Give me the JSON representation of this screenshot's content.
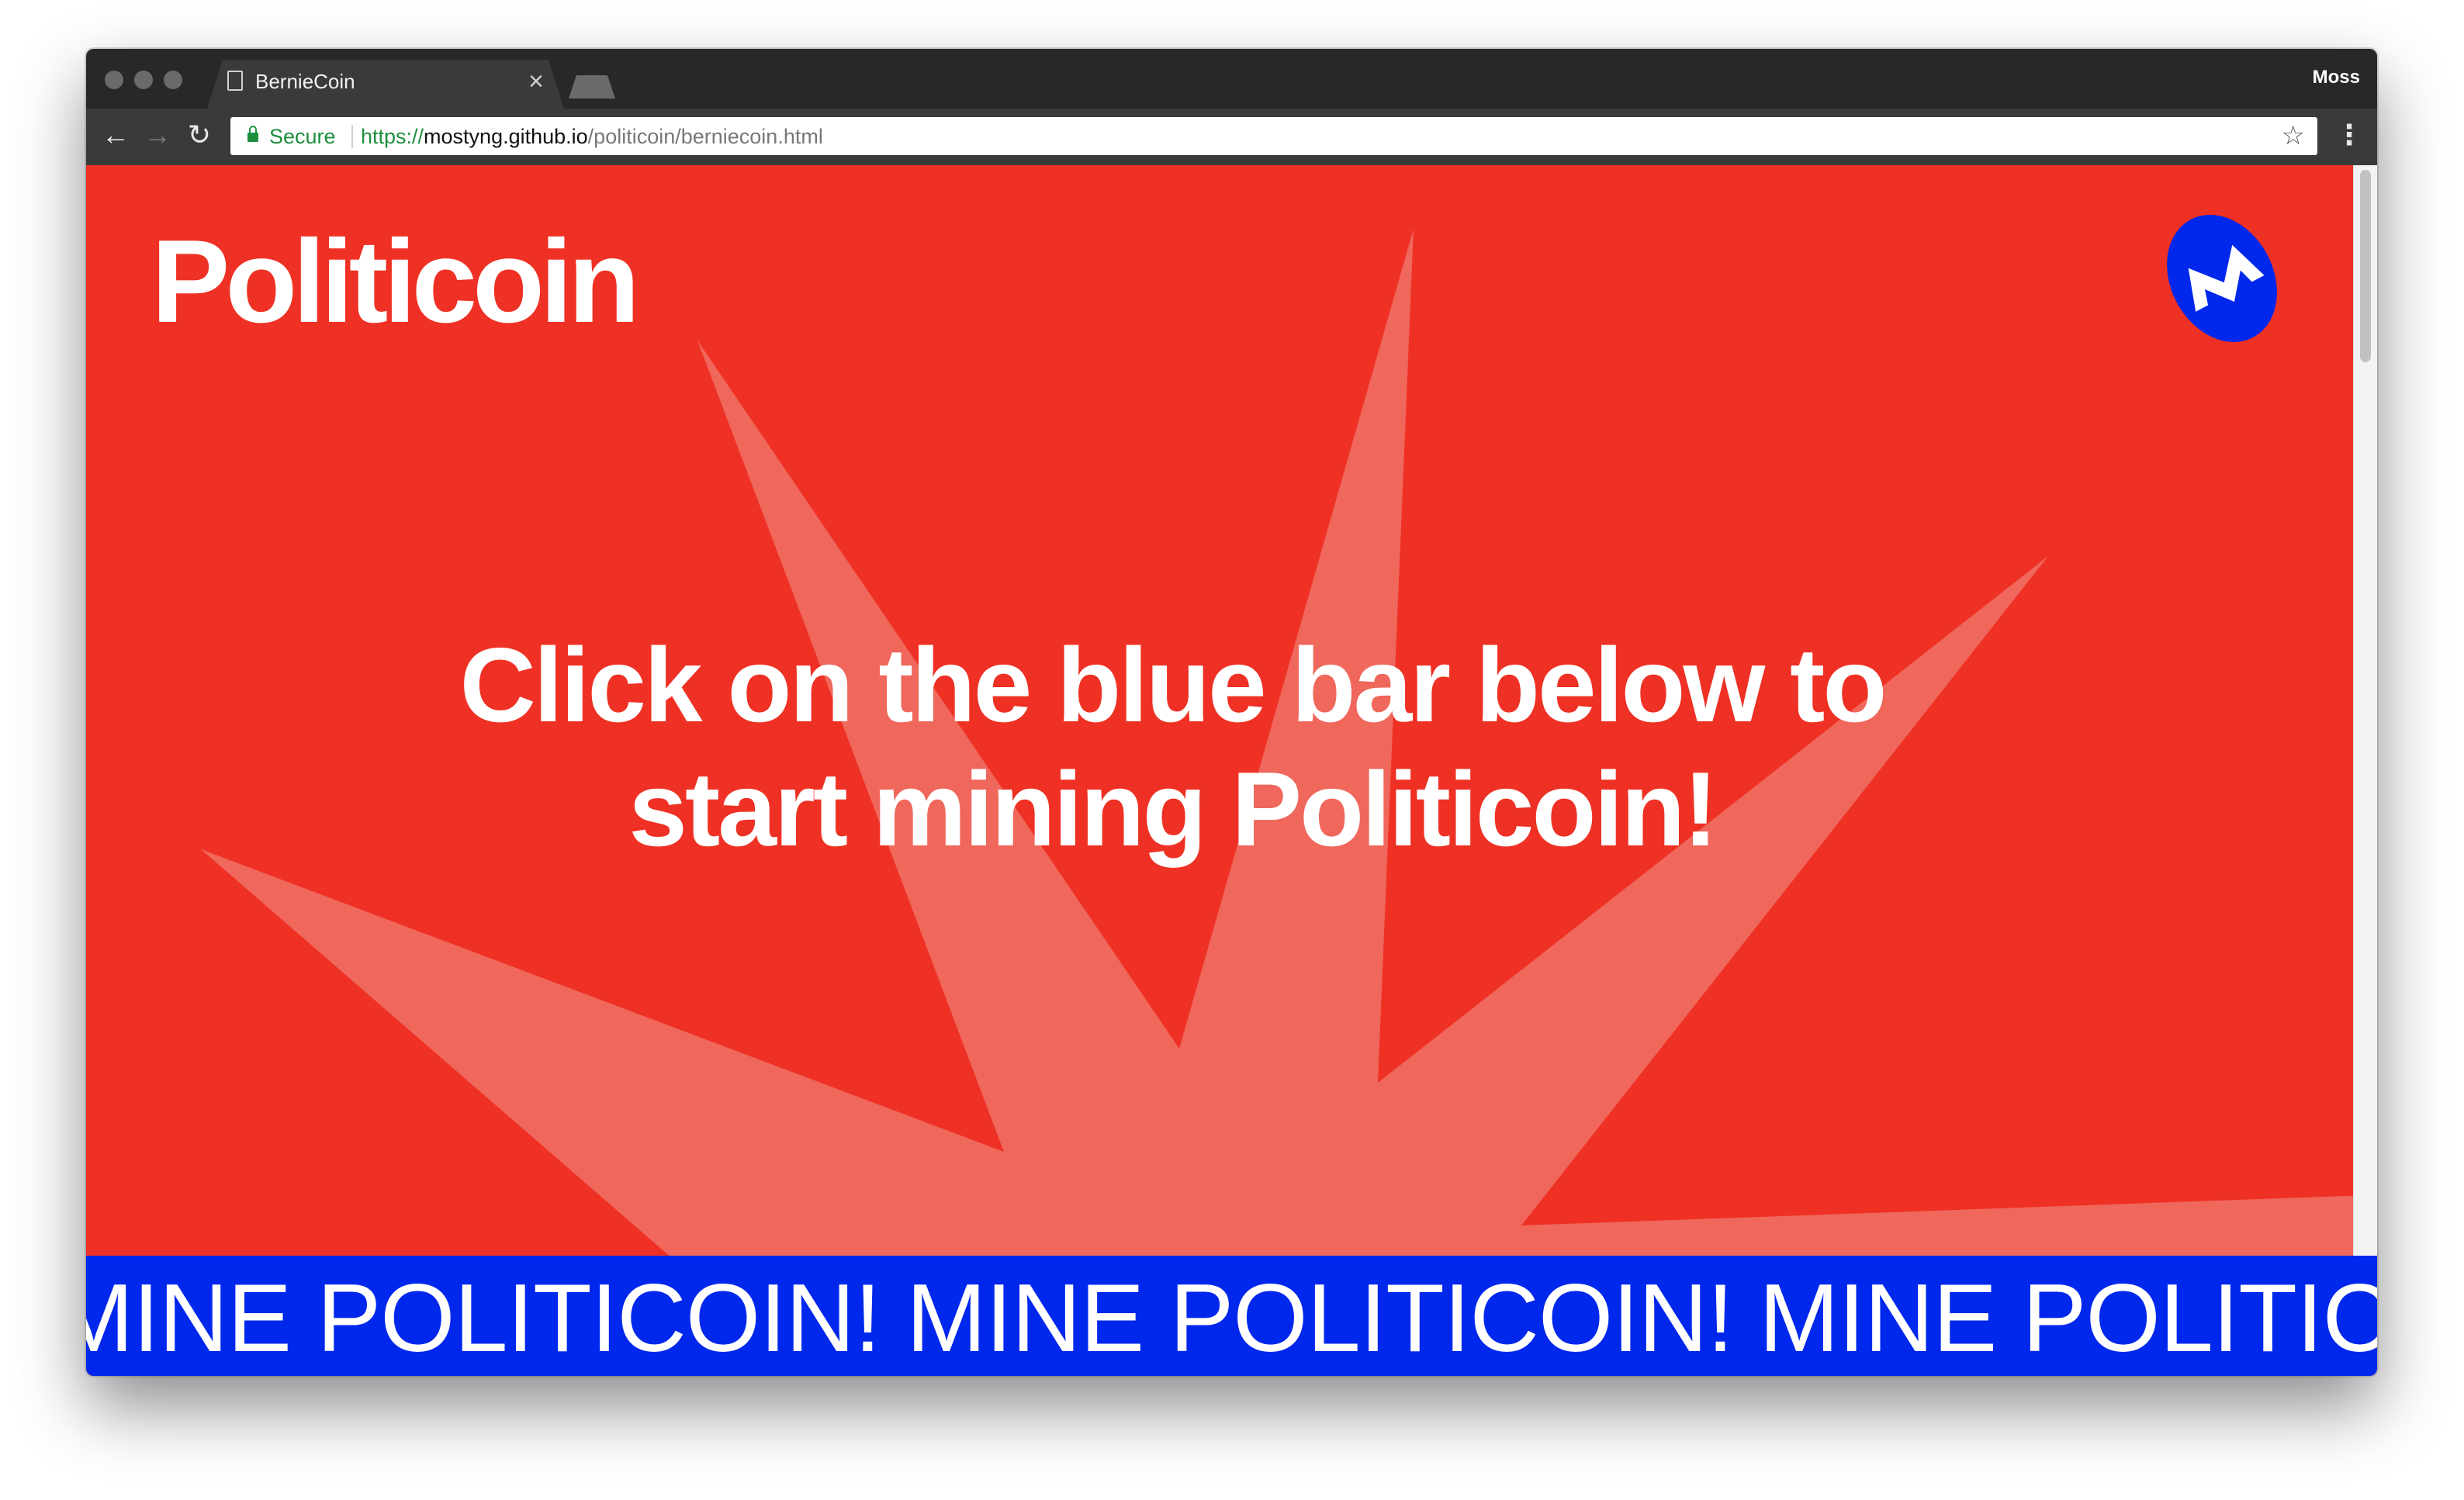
{
  "browser": {
    "tab_title": "BernieCoin",
    "tab_close": "×",
    "profile_name": "Moss",
    "back": "←",
    "forward": "→",
    "reload": "↻",
    "secure_label": "Secure",
    "url_scheme": "https://",
    "url_host": "mostyng.github.io",
    "url_path": "/politicoin/berniecoin.html",
    "star": "☆",
    "menu": "⋮"
  },
  "page": {
    "logo_text": "Politicoin",
    "headline_line1": "Click on the blue bar below to",
    "headline_line2": "start mining Politicoin!",
    "mine_bar_text": "MINE POLITICOIN! MINE POLITICOIN! MINE POLITICOIN! MINE POLITICOIN!",
    "colors": {
      "background_red": "#ee3124",
      "burst": "#f0675c",
      "mine_bar_blue": "#0027ec",
      "badge_blue": "#0027ec"
    },
    "icons": [
      "monero-logo-icon",
      "starburst-graphic"
    ]
  }
}
